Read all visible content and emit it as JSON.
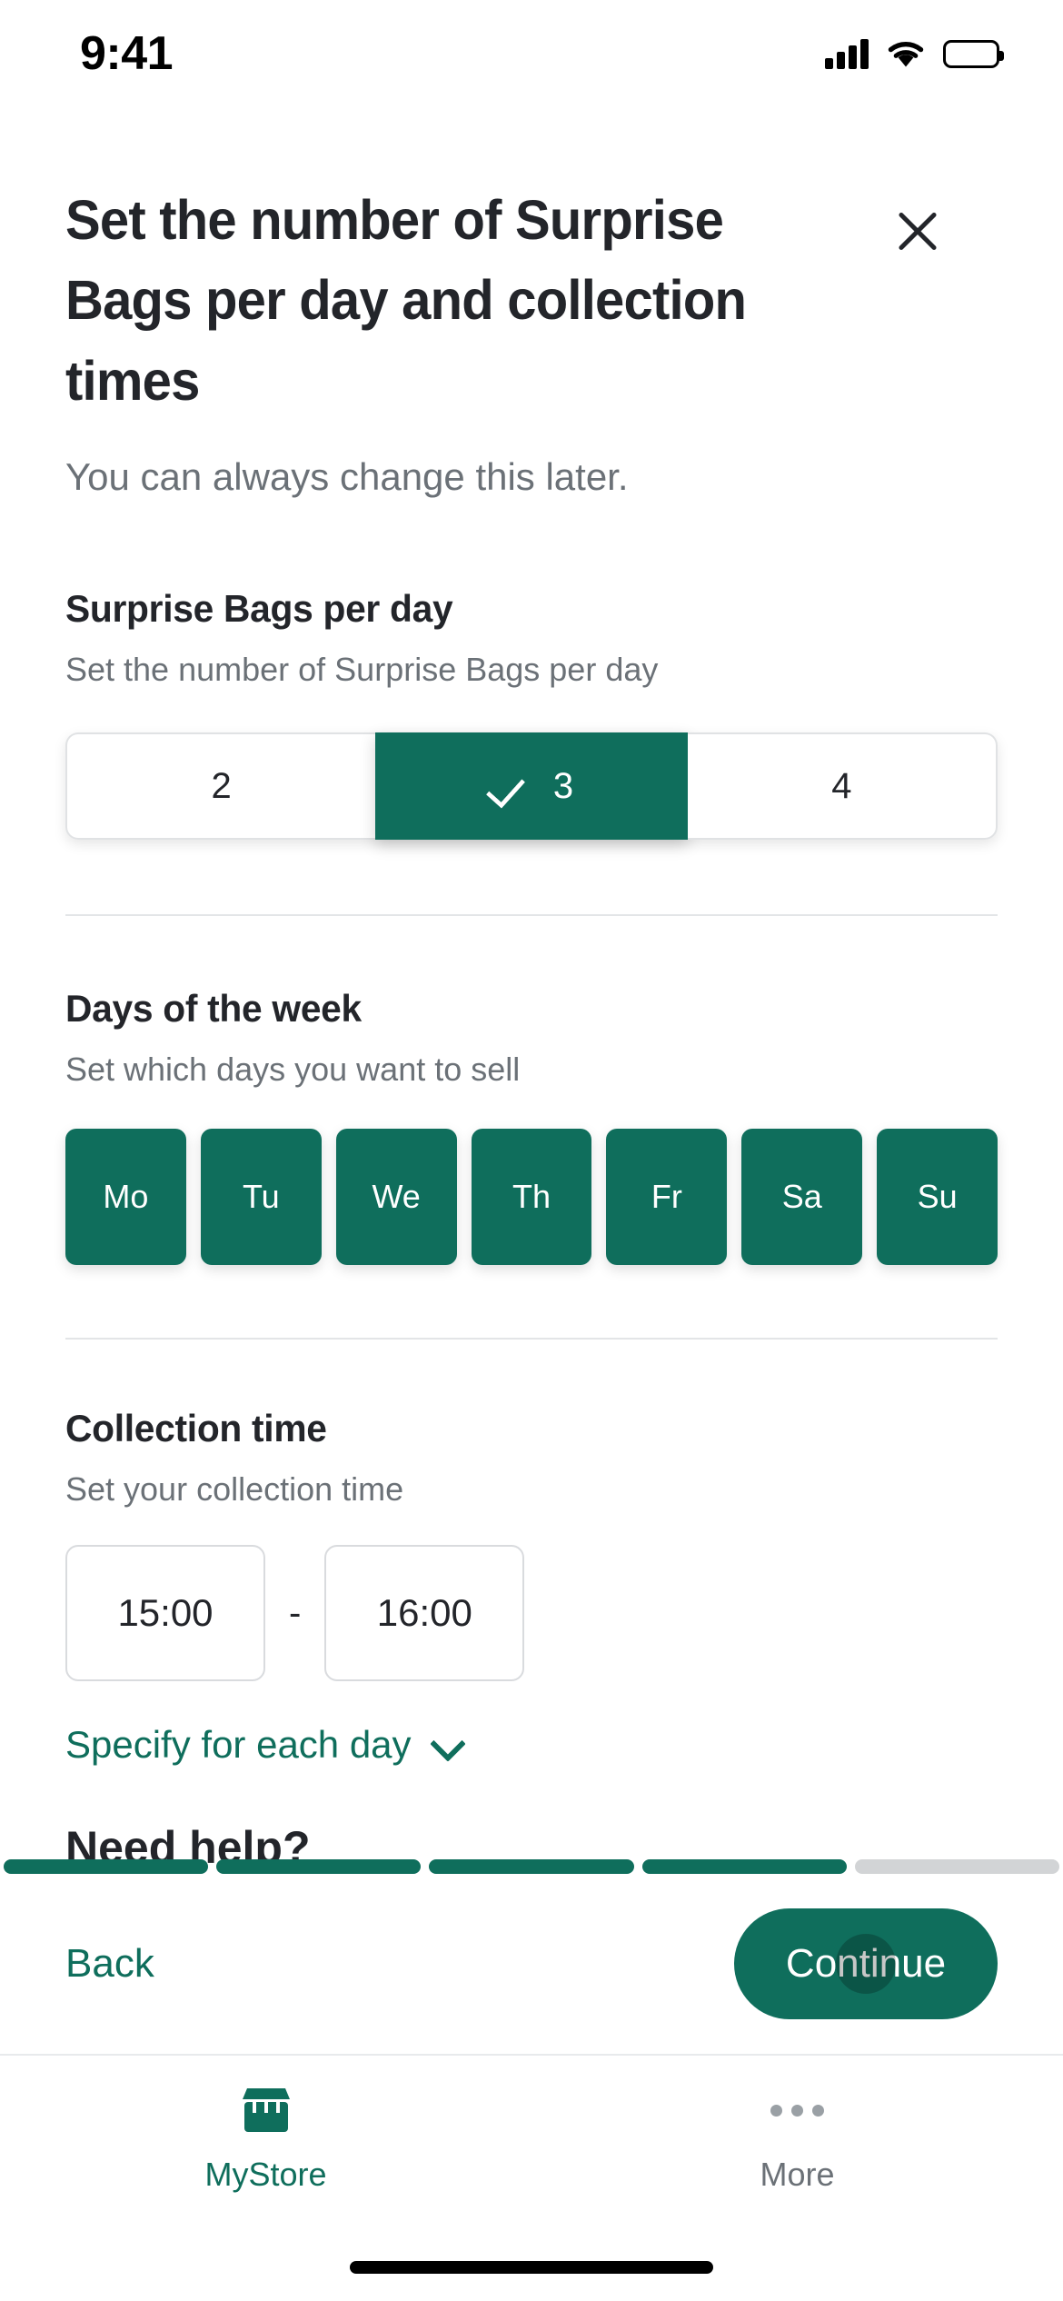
{
  "status_bar": {
    "time": "9:41",
    "signal_icon": "cellular-signal-icon",
    "wifi_icon": "wifi-icon",
    "battery_icon": "battery-full-icon"
  },
  "header": {
    "title": "Set the number of Surprise Bags per day and collection times",
    "subtitle": "You can always change this later.",
    "close_icon": "close-icon"
  },
  "bags_section": {
    "title": "Surprise Bags per day",
    "subtitle": "Set the number of Surprise Bags per day",
    "options": [
      {
        "label": "2",
        "selected": false
      },
      {
        "label": "3",
        "selected": true
      },
      {
        "label": "4",
        "selected": false
      }
    ],
    "selected_value": "3",
    "check_icon": "check-icon"
  },
  "days_section": {
    "title": "Days of the week",
    "subtitle": "Set which days you want to sell",
    "days": [
      {
        "label": "Mo",
        "selected": true
      },
      {
        "label": "Tu",
        "selected": true
      },
      {
        "label": "We",
        "selected": true
      },
      {
        "label": "Th",
        "selected": true
      },
      {
        "label": "Fr",
        "selected": true
      },
      {
        "label": "Sa",
        "selected": true
      },
      {
        "label": "Su",
        "selected": true
      }
    ]
  },
  "collection_section": {
    "title": "Collection time",
    "subtitle": "Set your collection time",
    "start_time": "15:00",
    "end_time": "16:00",
    "separator": "-",
    "specify_link": "Specify for each day",
    "chevron_icon": "chevron-down-icon"
  },
  "obscured_section": {
    "title": "Need help?"
  },
  "progress": {
    "total_steps": 5,
    "completed_steps": 4
  },
  "action_bar": {
    "back_label": "Back",
    "continue_label": "Continue"
  },
  "tab_bar": {
    "tabs": [
      {
        "label": "MyStore",
        "icon": "storefront-icon",
        "active": true
      },
      {
        "label": "More",
        "icon": "ellipsis-icon",
        "active": false
      }
    ]
  },
  "colors": {
    "brand_green": "#0f6e5c",
    "text_dark": "#23252a",
    "text_muted": "#6b7177",
    "border": "#e0e2e4",
    "progress_empty": "#d2d4d6"
  }
}
